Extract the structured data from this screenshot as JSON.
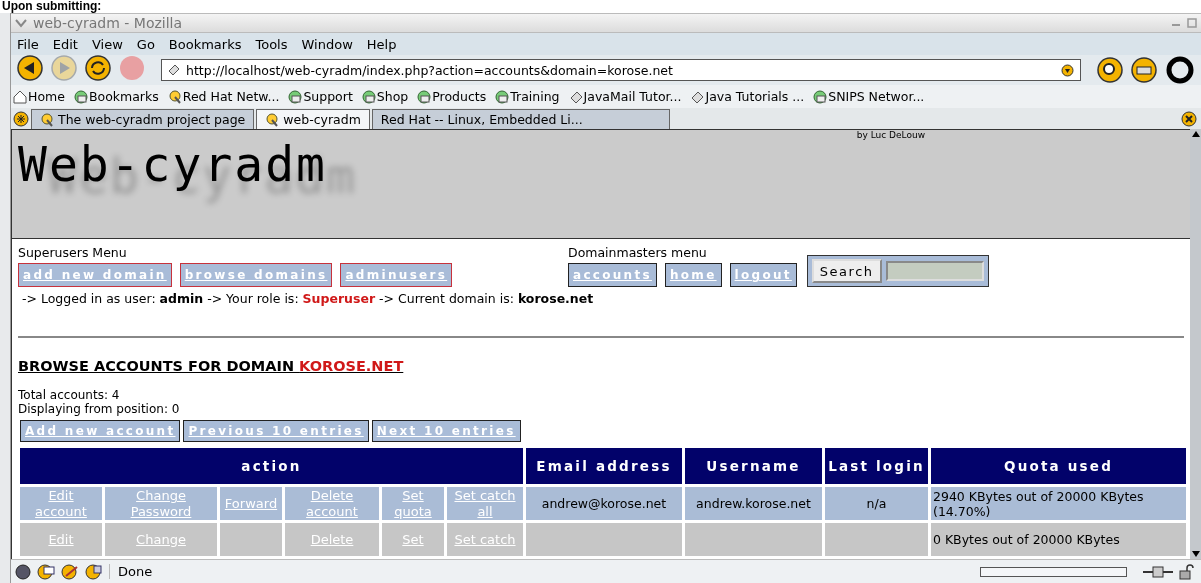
{
  "caption": "Upon submitting:",
  "window": {
    "title": "web-cyradm - Mozilla"
  },
  "menu": [
    "File",
    "Edit",
    "View",
    "Go",
    "Bookmarks",
    "Tools",
    "Window",
    "Help"
  ],
  "toolbar": {
    "url": "http://localhost/web-cyradm/index.php?action=accounts&domain=korose.net",
    "buttons": [
      {
        "kind": "back",
        "disabled": false
      },
      {
        "kind": "forward",
        "disabled": true
      },
      {
        "kind": "reload",
        "disabled": false
      },
      {
        "kind": "stop",
        "disabled": true
      }
    ]
  },
  "bookmarks": [
    {
      "label": "Home",
      "kind": "home"
    },
    {
      "label": "Bookmarks",
      "kind": "folder"
    },
    {
      "label": "Red Hat Netw...",
      "kind": "bookmark"
    },
    {
      "label": "Support",
      "kind": "folder"
    },
    {
      "label": "Shop",
      "kind": "folder"
    },
    {
      "label": "Products",
      "kind": "folder"
    },
    {
      "label": "Training",
      "kind": "folder"
    },
    {
      "label": "JavaMail Tutor...",
      "kind": "page"
    },
    {
      "label": "Java Tutorials ...",
      "kind": "page"
    },
    {
      "label": "SNIPS Networ...",
      "kind": "folder"
    }
  ],
  "tabs": [
    {
      "label": "The web-cyradm project page",
      "selected": false,
      "icon": true
    },
    {
      "label": "web-cyradm",
      "selected": true,
      "icon": true
    },
    {
      "label": "Red Hat -- Linux, Embedded Li...",
      "selected": false,
      "icon": false
    }
  ],
  "page": {
    "logo": "Web-cyradm",
    "credit": "by Luc DeLouw",
    "menus": [
      {
        "title": "Superusers Menu",
        "kind": "superuser",
        "items": [
          "add new domain",
          "browse domains",
          "adminusers"
        ]
      },
      {
        "title": "Domainmasters menu",
        "kind": "domainmaster",
        "items": [
          "accounts",
          "home",
          "logout"
        ]
      }
    ],
    "search_button": "Search",
    "status": [
      {
        "text": "-> Logged in as user: ",
        "kind": "plain"
      },
      {
        "text": "admin",
        "kind": "bold"
      },
      {
        "text": " -> Your role is: ",
        "kind": "plain"
      },
      {
        "text": "Superuser",
        "kind": "alert"
      },
      {
        "text": " -> Current domain is: ",
        "kind": "plain"
      },
      {
        "text": "korose.net",
        "kind": "bold"
      }
    ],
    "heading": [
      {
        "text": "BROWSE ACCOUNTS FOR DOMAIN ",
        "kind": "plain"
      },
      {
        "text": "KOROSE.NET",
        "kind": "alert"
      }
    ],
    "total": "Total accounts: 4",
    "position": "Displaying from position: 0",
    "nav": [
      "Add new account",
      "Previous 10 entries",
      "Next 10 entries"
    ],
    "table": {
      "columns": [
        "action",
        "Email address",
        "Username",
        "Last login",
        "Quota used"
      ],
      "rows": [
        {
          "actions": [
            {
              "kind": "link",
              "text": "Edit account"
            },
            {
              "kind": "link",
              "text": "Change Password"
            },
            {
              "kind": "link",
              "text": "Forward"
            },
            {
              "kind": "link",
              "text": "Delete account"
            },
            {
              "kind": "link",
              "text": "Set quota"
            },
            {
              "kind": "link",
              "text": "Set catch all"
            }
          ],
          "email": "andrew@korose.net",
          "username": "andrew.korose.net",
          "last_login": "n/a",
          "quota": "2940 KBytes out of 20000 KBytes (14.70%)"
        },
        {
          "actions": [
            {
              "kind": "link",
              "text": "Edit"
            },
            {
              "kind": "link",
              "text": "Change"
            },
            {
              "kind": "cut"
            },
            {
              "kind": "link",
              "text": "Delete"
            },
            {
              "kind": "link",
              "text": "Set"
            },
            {
              "kind": "link",
              "text": "Set catch"
            }
          ],
          "quota": "0 KBytes out of 20000 KBytes"
        }
      ]
    }
  },
  "status_bar": {
    "text": "Done"
  }
}
